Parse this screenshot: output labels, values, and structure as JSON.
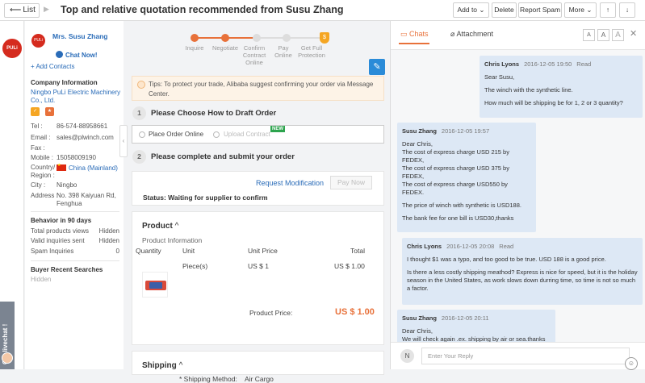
{
  "topbar": {
    "list_label": "List",
    "title": "Top and relative quotation recommended from Susu Zhang",
    "add_to": "Add to",
    "delete": "Delete",
    "report_spam": "Report Spam",
    "more": "More"
  },
  "rail": {
    "logo_text": "PULi",
    "livechat": "Get livechat !"
  },
  "contact": {
    "logo_text": "PULi",
    "name": "Mrs. Susu Zhang",
    "chat_now": "Chat Now!",
    "add_contacts": "Add Contacts",
    "company_info_header": "Company Information",
    "company_name": "Ningbo PuLi Electric Machinery Co., Ltd.",
    "tel_label": "Tel :",
    "tel": "86-574-88958661",
    "email_label": "Email :",
    "email": "sales@plwinch.com",
    "fax_label": "Fax :",
    "fax": "",
    "mobile_label": "Mobile :",
    "mobile": "15058009190",
    "country_label": "Country/ Region :",
    "country": "China (Mainland)",
    "city_label": "City :",
    "city": "Ningbo",
    "address_label": "Address :",
    "address": "No. 398 Kaiyuan Rd, Fenghua",
    "behavior_header": "Behavior in 90 days",
    "behavior": [
      {
        "label": "Total products views",
        "value": "Hidden"
      },
      {
        "label": "Valid inquiries sent",
        "value": "Hidden"
      },
      {
        "label": "Spam Inquiries",
        "value": "0"
      }
    ],
    "searches_header": "Buyer Recent Searches",
    "searches_value": "Hidden"
  },
  "steps": [
    {
      "label": "Inquire"
    },
    {
      "label": "Negotiate"
    },
    {
      "label": "Confirm Contract Online"
    },
    {
      "label": "Pay Online"
    },
    {
      "label": "Get Full Protection"
    }
  ],
  "tips": "Tips: To protect your trade, Alibaba suggest confirming your order via Message Center.",
  "section1": {
    "num": "1",
    "title": "Please Choose How to Draft Order",
    "option1": "Place Order Online",
    "option2": "Upload Contract",
    "new_tag": "NEW"
  },
  "section2": {
    "num": "2",
    "title": "Please complete and submit your order"
  },
  "status_card": {
    "request_modification": "Request Modification",
    "pay_now": "Pay Now",
    "status": "Status: Waiting for supplier to confirm"
  },
  "product": {
    "header": "Product",
    "info_label": "Product Information",
    "col_quantity": "Quantity",
    "col_unit": "Unit",
    "col_unit_price": "Unit Price",
    "col_total": "Total",
    "unit": "Piece(s)",
    "unit_price": "US $ 1",
    "total": "US $ 1.00",
    "product_price_label": "Product Price:",
    "product_price": "US $ 1.00"
  },
  "shipping": {
    "header": "Shipping",
    "method_label": "* Shipping Method:",
    "method": "Air Cargo"
  },
  "chat": {
    "tab_chats": "Chats",
    "tab_attachment": "Attachment",
    "font_a1": "A",
    "font_a2": "A",
    "font_a3": "A",
    "messages": [
      {
        "sender": "Chris Lyons",
        "time": "2016-12-05 19:50",
        "status": "Read",
        "lines": [
          "Sear Susu,",
          "The winch with the synthetic line.",
          "How much will be shipping be for 1, 2 or 3 quantity?"
        ]
      },
      {
        "sender": "Susu Zhang",
        "time": "2016-12-05 19:57",
        "status": "",
        "lines": [
          "Dear Chris,\nThe cost of express charge USD 215 by FEDEX,\nThe cost of express charge USD 375 by FEDEX,\nThe cost of express charge USD550 by FEDEX.",
          "The price of winch with synthetic is USD188.",
          "The bank fee for one bill is USD30,thanks"
        ]
      },
      {
        "sender": "Chris Lyons",
        "time": "2016-12-05 20:08",
        "status": "Read",
        "lines": [
          "I thought $1 was a typo, and too good to be true. USD 188 is a good price.",
          "Is there a less costly shipping meathod? Express is nice for speed, but it is the holiday season in the United States, as work slows down durring time, so time is not so much a factor."
        ]
      },
      {
        "sender": "Susu Zhang",
        "time": "2016-12-05 20:11",
        "status": "",
        "lines": [
          "Dear Chris,\nWe will check again .ex. shipping by air or sea.thanks"
        ]
      }
    ],
    "avatar_letter": "N",
    "input_placeholder": "Enter Your Reply"
  },
  "colors": {
    "accent": "#e8713a",
    "link": "#2a6cb8",
    "bubble": "#dde8f5"
  }
}
